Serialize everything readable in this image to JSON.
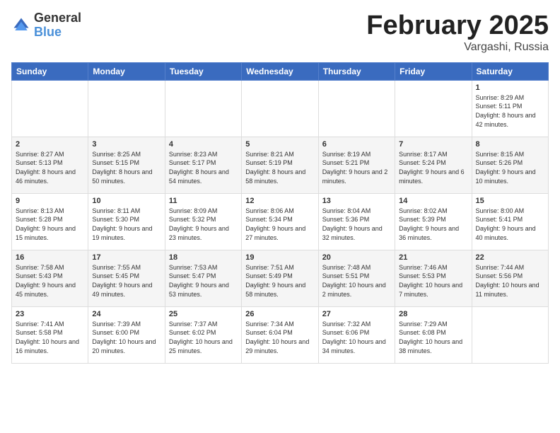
{
  "header": {
    "logo_general": "General",
    "logo_blue": "Blue",
    "month_title": "February 2025",
    "location": "Vargashi, Russia"
  },
  "days_of_week": [
    "Sunday",
    "Monday",
    "Tuesday",
    "Wednesday",
    "Thursday",
    "Friday",
    "Saturday"
  ],
  "weeks": [
    [
      {
        "day": "",
        "info": ""
      },
      {
        "day": "",
        "info": ""
      },
      {
        "day": "",
        "info": ""
      },
      {
        "day": "",
        "info": ""
      },
      {
        "day": "",
        "info": ""
      },
      {
        "day": "",
        "info": ""
      },
      {
        "day": "1",
        "info": "Sunrise: 8:29 AM\nSunset: 5:11 PM\nDaylight: 8 hours and 42 minutes."
      }
    ],
    [
      {
        "day": "2",
        "info": "Sunrise: 8:27 AM\nSunset: 5:13 PM\nDaylight: 8 hours and 46 minutes."
      },
      {
        "day": "3",
        "info": "Sunrise: 8:25 AM\nSunset: 5:15 PM\nDaylight: 8 hours and 50 minutes."
      },
      {
        "day": "4",
        "info": "Sunrise: 8:23 AM\nSunset: 5:17 PM\nDaylight: 8 hours and 54 minutes."
      },
      {
        "day": "5",
        "info": "Sunrise: 8:21 AM\nSunset: 5:19 PM\nDaylight: 8 hours and 58 minutes."
      },
      {
        "day": "6",
        "info": "Sunrise: 8:19 AM\nSunset: 5:21 PM\nDaylight: 9 hours and 2 minutes."
      },
      {
        "day": "7",
        "info": "Sunrise: 8:17 AM\nSunset: 5:24 PM\nDaylight: 9 hours and 6 minutes."
      },
      {
        "day": "8",
        "info": "Sunrise: 8:15 AM\nSunset: 5:26 PM\nDaylight: 9 hours and 10 minutes."
      }
    ],
    [
      {
        "day": "9",
        "info": "Sunrise: 8:13 AM\nSunset: 5:28 PM\nDaylight: 9 hours and 15 minutes."
      },
      {
        "day": "10",
        "info": "Sunrise: 8:11 AM\nSunset: 5:30 PM\nDaylight: 9 hours and 19 minutes."
      },
      {
        "day": "11",
        "info": "Sunrise: 8:09 AM\nSunset: 5:32 PM\nDaylight: 9 hours and 23 minutes."
      },
      {
        "day": "12",
        "info": "Sunrise: 8:06 AM\nSunset: 5:34 PM\nDaylight: 9 hours and 27 minutes."
      },
      {
        "day": "13",
        "info": "Sunrise: 8:04 AM\nSunset: 5:36 PM\nDaylight: 9 hours and 32 minutes."
      },
      {
        "day": "14",
        "info": "Sunrise: 8:02 AM\nSunset: 5:39 PM\nDaylight: 9 hours and 36 minutes."
      },
      {
        "day": "15",
        "info": "Sunrise: 8:00 AM\nSunset: 5:41 PM\nDaylight: 9 hours and 40 minutes."
      }
    ],
    [
      {
        "day": "16",
        "info": "Sunrise: 7:58 AM\nSunset: 5:43 PM\nDaylight: 9 hours and 45 minutes."
      },
      {
        "day": "17",
        "info": "Sunrise: 7:55 AM\nSunset: 5:45 PM\nDaylight: 9 hours and 49 minutes."
      },
      {
        "day": "18",
        "info": "Sunrise: 7:53 AM\nSunset: 5:47 PM\nDaylight: 9 hours and 53 minutes."
      },
      {
        "day": "19",
        "info": "Sunrise: 7:51 AM\nSunset: 5:49 PM\nDaylight: 9 hours and 58 minutes."
      },
      {
        "day": "20",
        "info": "Sunrise: 7:48 AM\nSunset: 5:51 PM\nDaylight: 10 hours and 2 minutes."
      },
      {
        "day": "21",
        "info": "Sunrise: 7:46 AM\nSunset: 5:53 PM\nDaylight: 10 hours and 7 minutes."
      },
      {
        "day": "22",
        "info": "Sunrise: 7:44 AM\nSunset: 5:56 PM\nDaylight: 10 hours and 11 minutes."
      }
    ],
    [
      {
        "day": "23",
        "info": "Sunrise: 7:41 AM\nSunset: 5:58 PM\nDaylight: 10 hours and 16 minutes."
      },
      {
        "day": "24",
        "info": "Sunrise: 7:39 AM\nSunset: 6:00 PM\nDaylight: 10 hours and 20 minutes."
      },
      {
        "day": "25",
        "info": "Sunrise: 7:37 AM\nSunset: 6:02 PM\nDaylight: 10 hours and 25 minutes."
      },
      {
        "day": "26",
        "info": "Sunrise: 7:34 AM\nSunset: 6:04 PM\nDaylight: 10 hours and 29 minutes."
      },
      {
        "day": "27",
        "info": "Sunrise: 7:32 AM\nSunset: 6:06 PM\nDaylight: 10 hours and 34 minutes."
      },
      {
        "day": "28",
        "info": "Sunrise: 7:29 AM\nSunset: 6:08 PM\nDaylight: 10 hours and 38 minutes."
      },
      {
        "day": "",
        "info": ""
      }
    ]
  ]
}
